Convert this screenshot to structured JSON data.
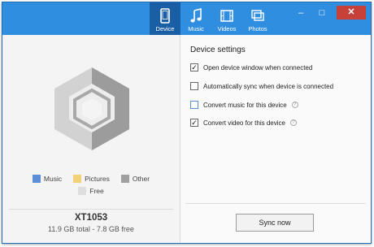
{
  "window": {
    "controls": {
      "minimize": "–",
      "maximize": "□",
      "close": "✕"
    }
  },
  "tabs": [
    {
      "label": "Device",
      "icon": "phone-icon",
      "active": true
    },
    {
      "label": "Music",
      "icon": "music-note-icon",
      "active": false
    },
    {
      "label": "Videos",
      "icon": "film-icon",
      "active": false
    },
    {
      "label": "Photos",
      "icon": "photos-icon",
      "active": false
    }
  ],
  "storage": {
    "legend": [
      {
        "label": "Music",
        "color": "#5b8fd6"
      },
      {
        "label": "Pictures",
        "color": "#f3d07a"
      },
      {
        "label": "Other",
        "color": "#a0a0a0"
      },
      {
        "label": "Free",
        "color": "#dedede"
      }
    ],
    "device_name": "XT1053",
    "summary": "11.9 GB total - 7.8 GB free"
  },
  "settings": {
    "title": "Device settings",
    "options": [
      {
        "label": "Open device window when connected",
        "checked": true,
        "info": false
      },
      {
        "label": "Automatically sync when device is connected",
        "checked": false,
        "info": false
      },
      {
        "label": "Convert music for this device",
        "checked": false,
        "info": true
      },
      {
        "label": "Convert video for this device",
        "checked": true,
        "info": true
      }
    ],
    "check_glyph": "✓",
    "info_glyph": "?"
  },
  "sync_button": {
    "label": "Sync now"
  },
  "colors": {
    "titlebar": "#2f8ee0",
    "active_tab": "#1a5fa5",
    "hex_light": "#d0d0d0",
    "hex_dark": "#9a9a9a"
  }
}
